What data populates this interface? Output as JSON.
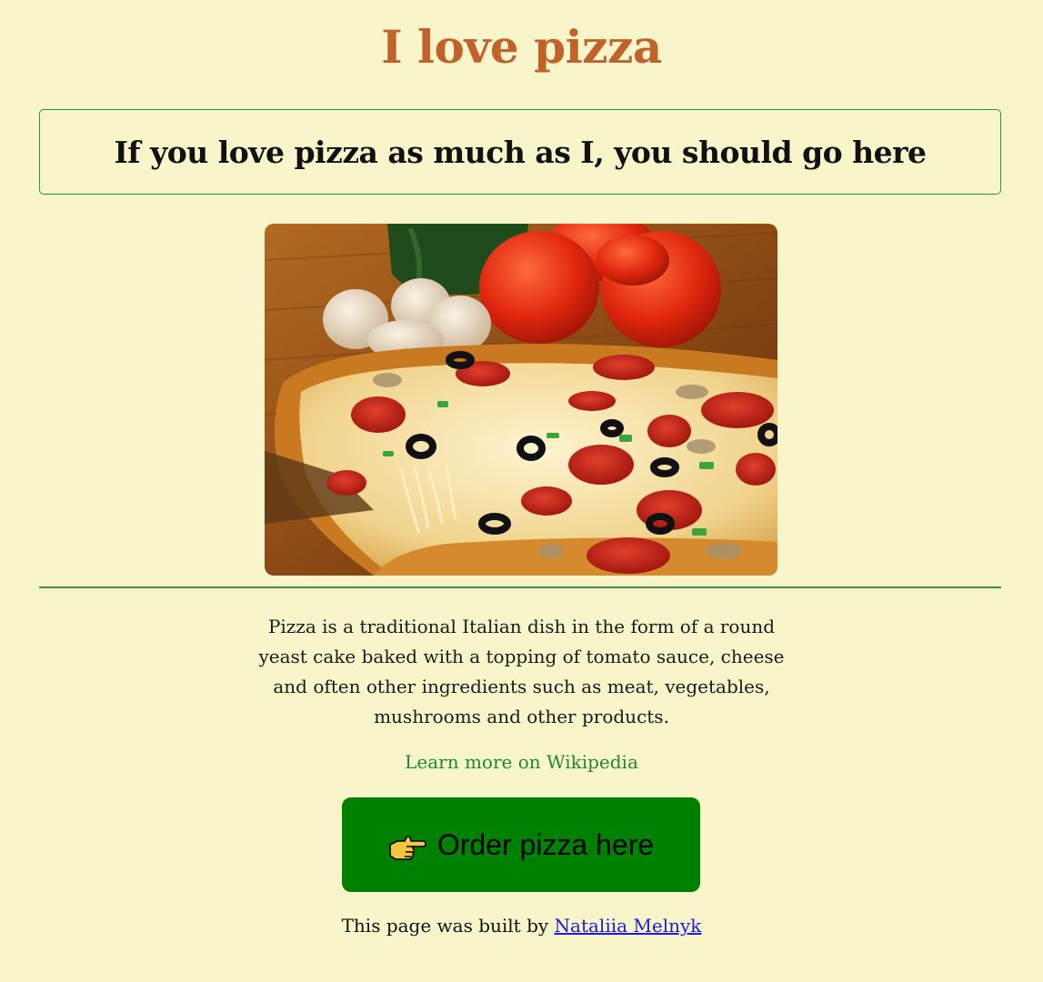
{
  "header": {
    "title": "I love pizza"
  },
  "callout": {
    "heading": "If you love pizza as much as I, you should go here"
  },
  "image": {
    "alt": "pizza-photo"
  },
  "description": {
    "text": "Pizza is a traditional Italian dish in the form of a round yeast cake baked with a topping of tomato sauce, cheese and often other ingredients such as meat, vegetables, mushrooms and other products."
  },
  "links": {
    "wikipedia_label": "Learn more on Wikipedia"
  },
  "order_button": {
    "label": "Order pizza here",
    "icon": "pointing-hand-icon"
  },
  "footer": {
    "prefix": "This page was built by",
    "author": "Nataliia Melnyk"
  },
  "colors": {
    "background": "#f7f5c9",
    "title": "#c0622a",
    "accent_green": "#008000",
    "link_green": "#1f8a2c",
    "author_link": "#1a1ae0"
  }
}
